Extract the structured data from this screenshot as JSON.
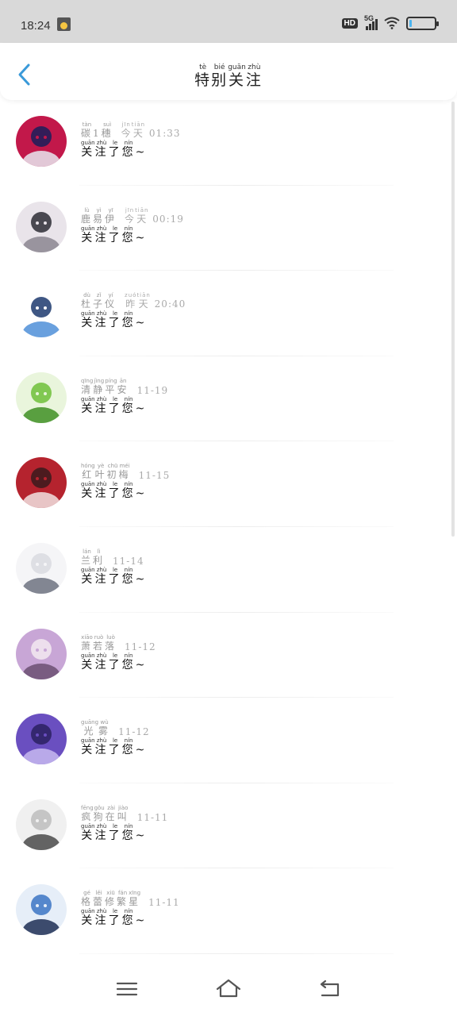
{
  "status_bar": {
    "time": "18:24",
    "hd_label": "HD",
    "network_label": "5G",
    "battery_level": 0.1
  },
  "header": {
    "title": [
      {
        "char": "特",
        "py": "tè"
      },
      {
        "char": "别",
        "py": "bié"
      },
      {
        "char": "关",
        "py": "guān"
      },
      {
        "char": "注",
        "py": "zhù"
      }
    ]
  },
  "colors": {
    "accent": "#3a9ad9",
    "muted_text": "#999999",
    "status_bar_bg": "#d9d9d9"
  },
  "items": [
    {
      "name": [
        {
          "char": "碳",
          "py": "tàn"
        },
        {
          "char": "1",
          "py": ""
        },
        {
          "char": "穗",
          "py": "suì"
        }
      ],
      "time": [
        {
          "char": "今",
          "py": "jīn"
        },
        {
          "char": "天",
          "py": "tiān"
        },
        {
          "char": " 01:33",
          "py": ""
        }
      ],
      "message": [
        {
          "char": "关",
          "py": "guān"
        },
        {
          "char": "注",
          "py": "zhù"
        },
        {
          "char": "了",
          "py": "le"
        },
        {
          "char": "您",
          "py": "nín"
        },
        {
          "char": "~",
          "py": ""
        }
      ],
      "avatar_colors": [
        "#1a1f5a",
        "#c2184a",
        "#e8e8f0"
      ]
    },
    {
      "name": [
        {
          "char": "鹿",
          "py": "lù"
        },
        {
          "char": "易",
          "py": "yì"
        },
        {
          "char": "伊",
          "py": "yī"
        }
      ],
      "time": [
        {
          "char": "今",
          "py": "jīn"
        },
        {
          "char": "天",
          "py": "tiān"
        },
        {
          "char": " 00:19",
          "py": ""
        }
      ],
      "message": [
        {
          "char": "关",
          "py": "guān"
        },
        {
          "char": "注",
          "py": "zhù"
        },
        {
          "char": "了",
          "py": "le"
        },
        {
          "char": "您",
          "py": "nín"
        },
        {
          "char": "~",
          "py": ""
        }
      ],
      "avatar_colors": [
        "#2d2d35",
        "#e9e4ea",
        "#8b8690"
      ]
    },
    {
      "name": [
        {
          "char": "杜",
          "py": "dù"
        },
        {
          "char": "子",
          "py": "zǐ"
        },
        {
          "char": "仪",
          "py": "yí"
        }
      ],
      "time": [
        {
          "char": "昨",
          "py": "zuó"
        },
        {
          "char": "天",
          "py": "tiān"
        },
        {
          "char": " 20:40",
          "py": ""
        }
      ],
      "message": [
        {
          "char": "关",
          "py": "guān"
        },
        {
          "char": "注",
          "py": "zhù"
        },
        {
          "char": "了",
          "py": "le"
        },
        {
          "char": "您",
          "py": "nín"
        },
        {
          "char": "~",
          "py": ""
        }
      ],
      "avatar_colors": [
        "#1d3a6e",
        "#ffffff",
        "#4f8fd8"
      ]
    },
    {
      "name": [
        {
          "char": "清",
          "py": "qīng"
        },
        {
          "char": "静",
          "py": "jìng"
        },
        {
          "char": "平",
          "py": "píng"
        },
        {
          "char": "安",
          "py": "ān"
        }
      ],
      "time": [
        {
          "char": "11-19",
          "py": ""
        }
      ],
      "message": [
        {
          "char": "关",
          "py": "guān"
        },
        {
          "char": "注",
          "py": "zhù"
        },
        {
          "char": "了",
          "py": "le"
        },
        {
          "char": "您",
          "py": "nín"
        },
        {
          "char": "~",
          "py": ""
        }
      ],
      "avatar_colors": [
        "#6fbf3a",
        "#e9f5dc",
        "#3f8f25"
      ]
    },
    {
      "name": [
        {
          "char": "红",
          "py": "hóng"
        },
        {
          "char": "叶",
          "py": "yè"
        },
        {
          "char": "初",
          "py": "chū"
        },
        {
          "char": "梅",
          "py": "méi"
        }
      ],
      "time": [
        {
          "char": "11-15",
          "py": ""
        }
      ],
      "message": [
        {
          "char": "关",
          "py": "guān"
        },
        {
          "char": "注",
          "py": "zhù"
        },
        {
          "char": "了",
          "py": "le"
        },
        {
          "char": "您",
          "py": "nín"
        },
        {
          "char": "~",
          "py": ""
        }
      ],
      "avatar_colors": [
        "#3a1a1c",
        "#b5232e",
        "#f1e2e0"
      ]
    },
    {
      "name": [
        {
          "char": "兰",
          "py": "lán"
        },
        {
          "char": "利",
          "py": "lì"
        }
      ],
      "time": [
        {
          "char": "11-14",
          "py": ""
        }
      ],
      "message": [
        {
          "char": "关",
          "py": "guān"
        },
        {
          "char": "注",
          "py": "zhù"
        },
        {
          "char": "了",
          "py": "le"
        },
        {
          "char": "您",
          "py": "nín"
        },
        {
          "char": "~",
          "py": ""
        }
      ],
      "avatar_colors": [
        "#d9dbe0",
        "#f5f5f7",
        "#6d7280"
      ]
    },
    {
      "name": [
        {
          "char": "萧",
          "py": "xiāo"
        },
        {
          "char": "若",
          "py": "ruò"
        },
        {
          "char": "落",
          "py": "luò"
        }
      ],
      "time": [
        {
          "char": "11-12",
          "py": ""
        }
      ],
      "message": [
        {
          "char": "关",
          "py": "guān"
        },
        {
          "char": "注",
          "py": "zhù"
        },
        {
          "char": "了",
          "py": "le"
        },
        {
          "char": "您",
          "py": "nín"
        },
        {
          "char": "~",
          "py": ""
        }
      ],
      "avatar_colors": [
        "#f3e9f1",
        "#c8a6d6",
        "#6b4f72"
      ]
    },
    {
      "name": [
        {
          "char": "光",
          "py": "guāng"
        },
        {
          "char": "雾",
          "py": "wù"
        }
      ],
      "time": [
        {
          "char": "11-12",
          "py": ""
        }
      ],
      "message": [
        {
          "char": "关",
          "py": "guān"
        },
        {
          "char": "注",
          "py": "zhù"
        },
        {
          "char": "了",
          "py": "le"
        },
        {
          "char": "您",
          "py": "nín"
        },
        {
          "char": "~",
          "py": ""
        }
      ],
      "avatar_colors": [
        "#2a2060",
        "#6a4fc0",
        "#c7b8f0"
      ]
    },
    {
      "name": [
        {
          "char": "疯",
          "py": "fēng"
        },
        {
          "char": "狗",
          "py": "gǒu"
        },
        {
          "char": "在",
          "py": "zài"
        },
        {
          "char": "叫",
          "py": "jiào"
        }
      ],
      "time": [
        {
          "char": "11-11",
          "py": ""
        }
      ],
      "message": [
        {
          "char": "关",
          "py": "guān"
        },
        {
          "char": "注",
          "py": "zhù"
        },
        {
          "char": "了",
          "py": "le"
        },
        {
          "char": "您",
          "py": "nín"
        },
        {
          "char": "~",
          "py": ""
        }
      ],
      "avatar_colors": [
        "#bdbdbd",
        "#f0f0f0",
        "#4a4a4a"
      ]
    },
    {
      "name": [
        {
          "char": "格",
          "py": "gé"
        },
        {
          "char": "蕾",
          "py": "lěi"
        },
        {
          "char": "修",
          "py": "xiū"
        },
        {
          "char": "繁",
          "py": "fán"
        },
        {
          "char": "星",
          "py": "xīng"
        }
      ],
      "time": [
        {
          "char": "11-11",
          "py": ""
        }
      ],
      "message": [
        {
          "char": "关",
          "py": "guān"
        },
        {
          "char": "注",
          "py": "zhù"
        },
        {
          "char": "了",
          "py": "le"
        },
        {
          "char": "您",
          "py": "nín"
        },
        {
          "char": "~",
          "py": ""
        }
      ],
      "avatar_colors": [
        "#3b74c4",
        "#e6eef8",
        "#1d2e55"
      ]
    }
  ],
  "nav": {
    "icons": [
      "menu-icon",
      "home-icon",
      "back-icon"
    ]
  }
}
